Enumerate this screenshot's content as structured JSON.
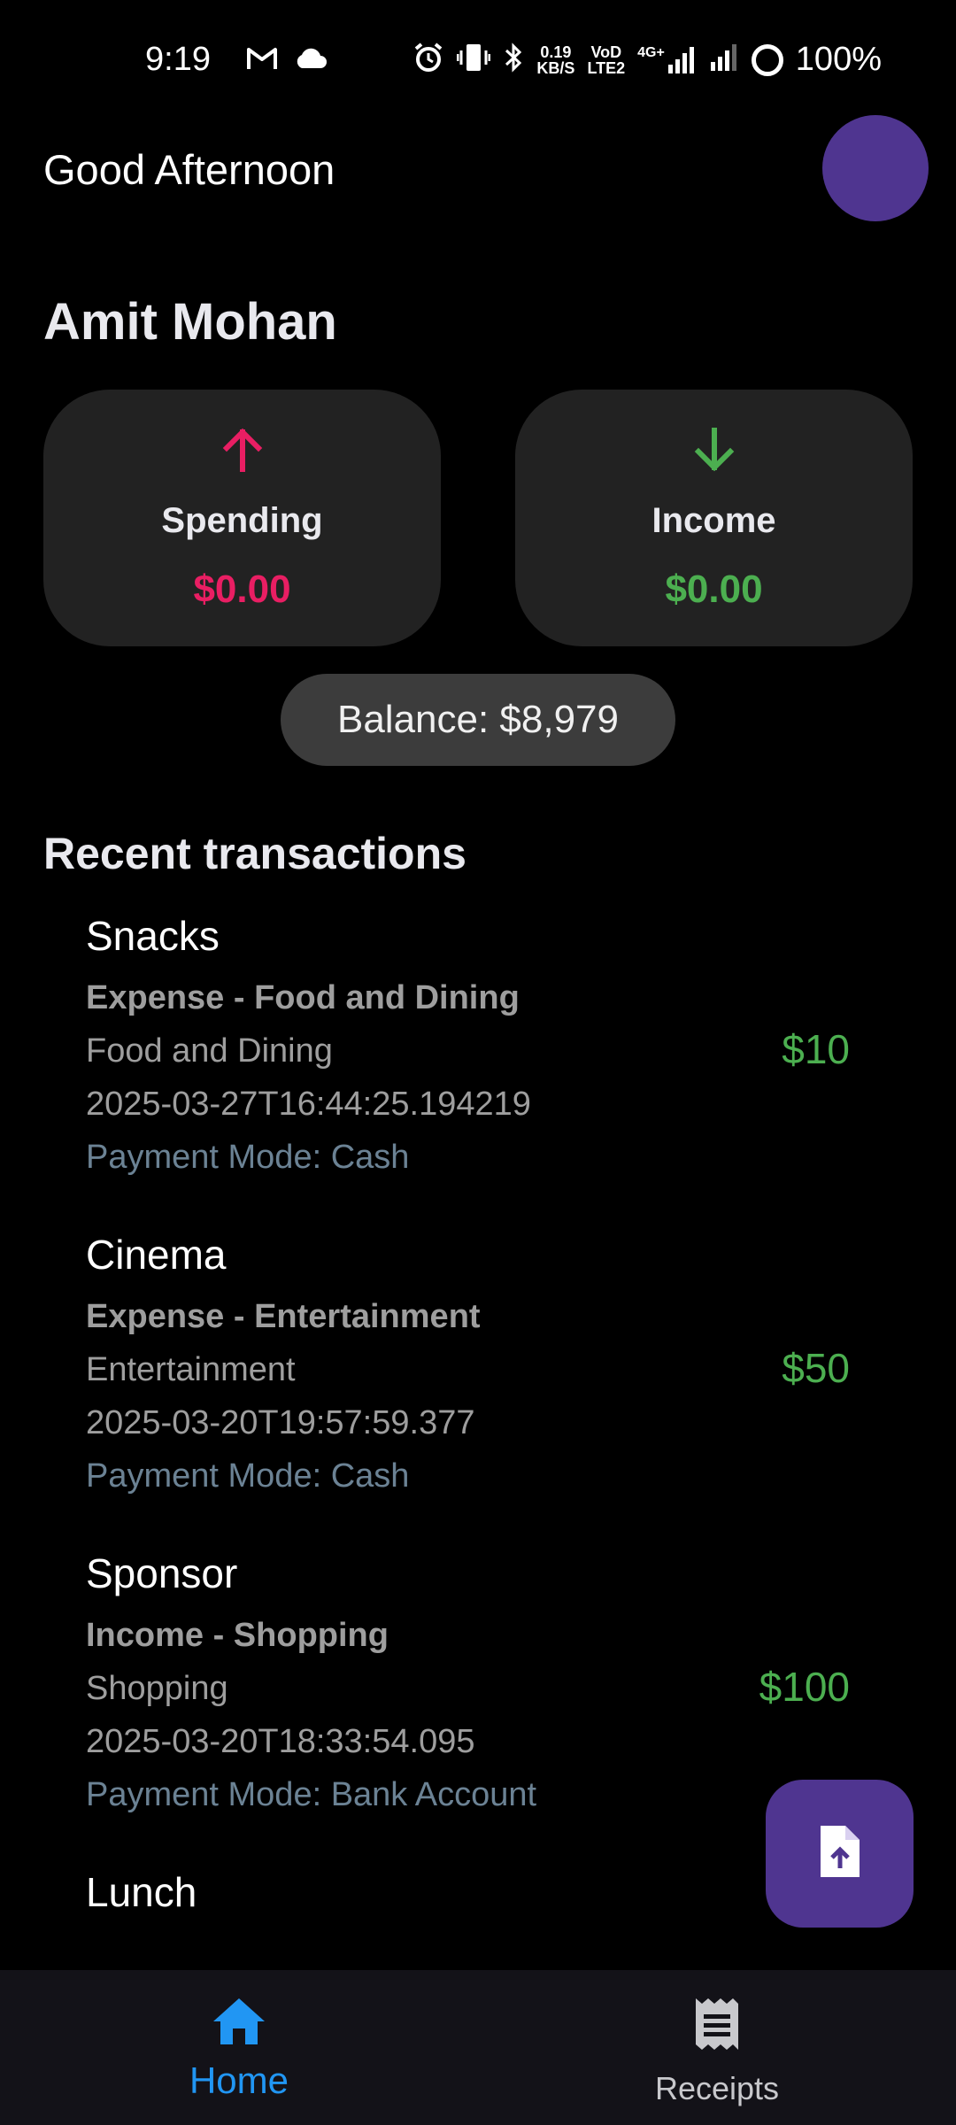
{
  "status_bar": {
    "time": "9:19",
    "net_speed_value": "0.19",
    "net_speed_unit": "KB/S",
    "volte_top": "VoD",
    "volte_bottom": "LTE2",
    "network_type": "4G+",
    "battery": "100%",
    "icons": [
      "gmail-icon",
      "cloud-icon",
      "alarm-icon",
      "vibrate-icon",
      "bluetooth-icon",
      "signal-icon",
      "signal-icon",
      "battery-icon"
    ]
  },
  "header": {
    "greeting": "Good Afternoon",
    "user_name": "Amit Mohan"
  },
  "summary": {
    "spending": {
      "label": "Spending",
      "amount": "$0.00",
      "icon": "arrow-up-icon"
    },
    "income": {
      "label": "Income",
      "amount": "$0.00",
      "icon": "arrow-down-icon"
    },
    "balance": "Balance: $8,979"
  },
  "recent": {
    "title": "Recent transactions",
    "items": [
      {
        "title": "Snacks",
        "type": "Expense - Food and Dining",
        "category": "Food and Dining",
        "date": "2025-03-27T16:44:25.194219",
        "payment": "Payment Mode: Cash",
        "amount": "$10"
      },
      {
        "title": "Cinema",
        "type": "Expense - Entertainment",
        "category": "Entertainment",
        "date": "2025-03-20T19:57:59.377",
        "payment": "Payment Mode: Cash",
        "amount": "$50"
      },
      {
        "title": "Sponsor",
        "type": "Income - Shopping",
        "category": "Shopping",
        "date": "2025-03-20T18:33:54.095",
        "payment": "Payment Mode: Bank Account",
        "amount": "$100"
      },
      {
        "title": "Lunch"
      }
    ]
  },
  "fab": {
    "icon": "file-upload-icon"
  },
  "nav": {
    "home_label": "Home",
    "receipts_label": "Receipts"
  },
  "colors": {
    "accent_purple": "#4f3590",
    "spending_red": "#e91e63",
    "income_green": "#4caf50",
    "nav_active_blue": "#2196f3"
  }
}
